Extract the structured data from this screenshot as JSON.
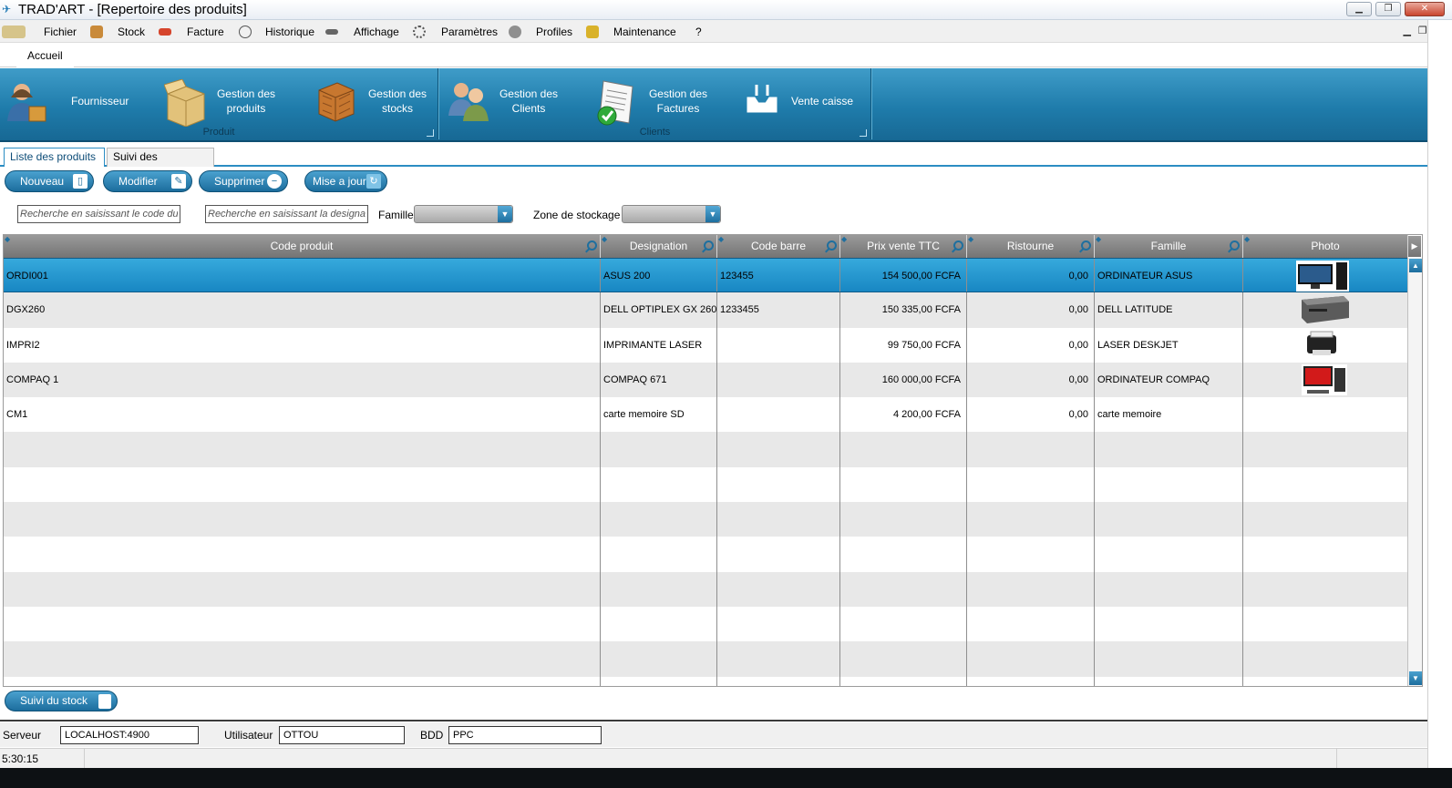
{
  "window": {
    "title": "TRAD'ART - [Repertoire des produits]"
  },
  "menu": {
    "items": [
      "Fichier",
      "Stock",
      "Facture",
      "Historique",
      "Affichage",
      "Paramètres",
      "Profiles",
      "Maintenance",
      "?"
    ]
  },
  "ribbon": {
    "tab": "Accueil",
    "groups": [
      {
        "label": "Produit",
        "buttons": [
          "Fournisseur",
          "Gestion des produits",
          "Gestion des stocks"
        ]
      },
      {
        "label": "Clients",
        "buttons": [
          "Gestion des Clients",
          "Gestion des Factures",
          "Vente caisse"
        ]
      }
    ]
  },
  "doc_tabs": [
    "Liste des produits",
    "Suivi des mouvements"
  ],
  "actions": {
    "new": "Nouveau",
    "edit": "Modifier",
    "delete": "Supprimer",
    "update": "Mise a jour"
  },
  "filters": {
    "code_placeholder": "Recherche en saisissant le code du p",
    "designation_placeholder": "Recherche en saisissant la designat",
    "famille_label": "Famille",
    "famille_value": "",
    "zone_label": "Zone de stockage",
    "zone_value": ""
  },
  "table": {
    "columns": [
      "Code produit",
      "Designation",
      "Code barre",
      "Prix vente TTC",
      "Ristourne",
      "Famille",
      "Photo"
    ],
    "rows": [
      {
        "code": "ORDI001",
        "designation": "ASUS 200",
        "barcode": "123455",
        "price": "154 500,00 FCFA",
        "discount": "0,00",
        "family": "ORDINATEUR ASUS",
        "photo": "asus-desktop"
      },
      {
        "code": "DGX260",
        "designation": "DELL OPTIPLEX GX 260",
        "barcode": "1233455",
        "price": "150 335,00 FCFA",
        "discount": "0,00",
        "family": "DELL LATITUDE",
        "photo": "dell-desktop"
      },
      {
        "code": "IMPRI2",
        "designation": "IMPRIMANTE LASER",
        "barcode": "",
        "price": "99 750,00 FCFA",
        "discount": "0,00",
        "family": "LASER DESKJET",
        "photo": "printer"
      },
      {
        "code": "COMPAQ 1",
        "designation": "COMPAQ 671",
        "barcode": "",
        "price": "160 000,00 FCFA",
        "discount": "0,00",
        "family": "ORDINATEUR COMPAQ",
        "photo": "compaq-desktop"
      },
      {
        "code": "CM1",
        "designation": "carte memoire SD",
        "barcode": "",
        "price": "4 200,00 FCFA",
        "discount": "0,00",
        "family": "carte memoire",
        "photo": ""
      }
    ],
    "selected_index": 0
  },
  "footer": {
    "stock_button": "Suivi du stock",
    "server_label": "Serveur",
    "server_value": "LOCALHOST:4900",
    "user_label": "Utilisateur",
    "user_value": "OTTOU",
    "db_label": "BDD",
    "db_value": "PPC",
    "clock": "5:30:15"
  },
  "colors": {
    "ribbon": "#1f7cab",
    "accent": "#2b8dc3",
    "selected_row": "#1887c3",
    "header": "#8a8a8a"
  }
}
